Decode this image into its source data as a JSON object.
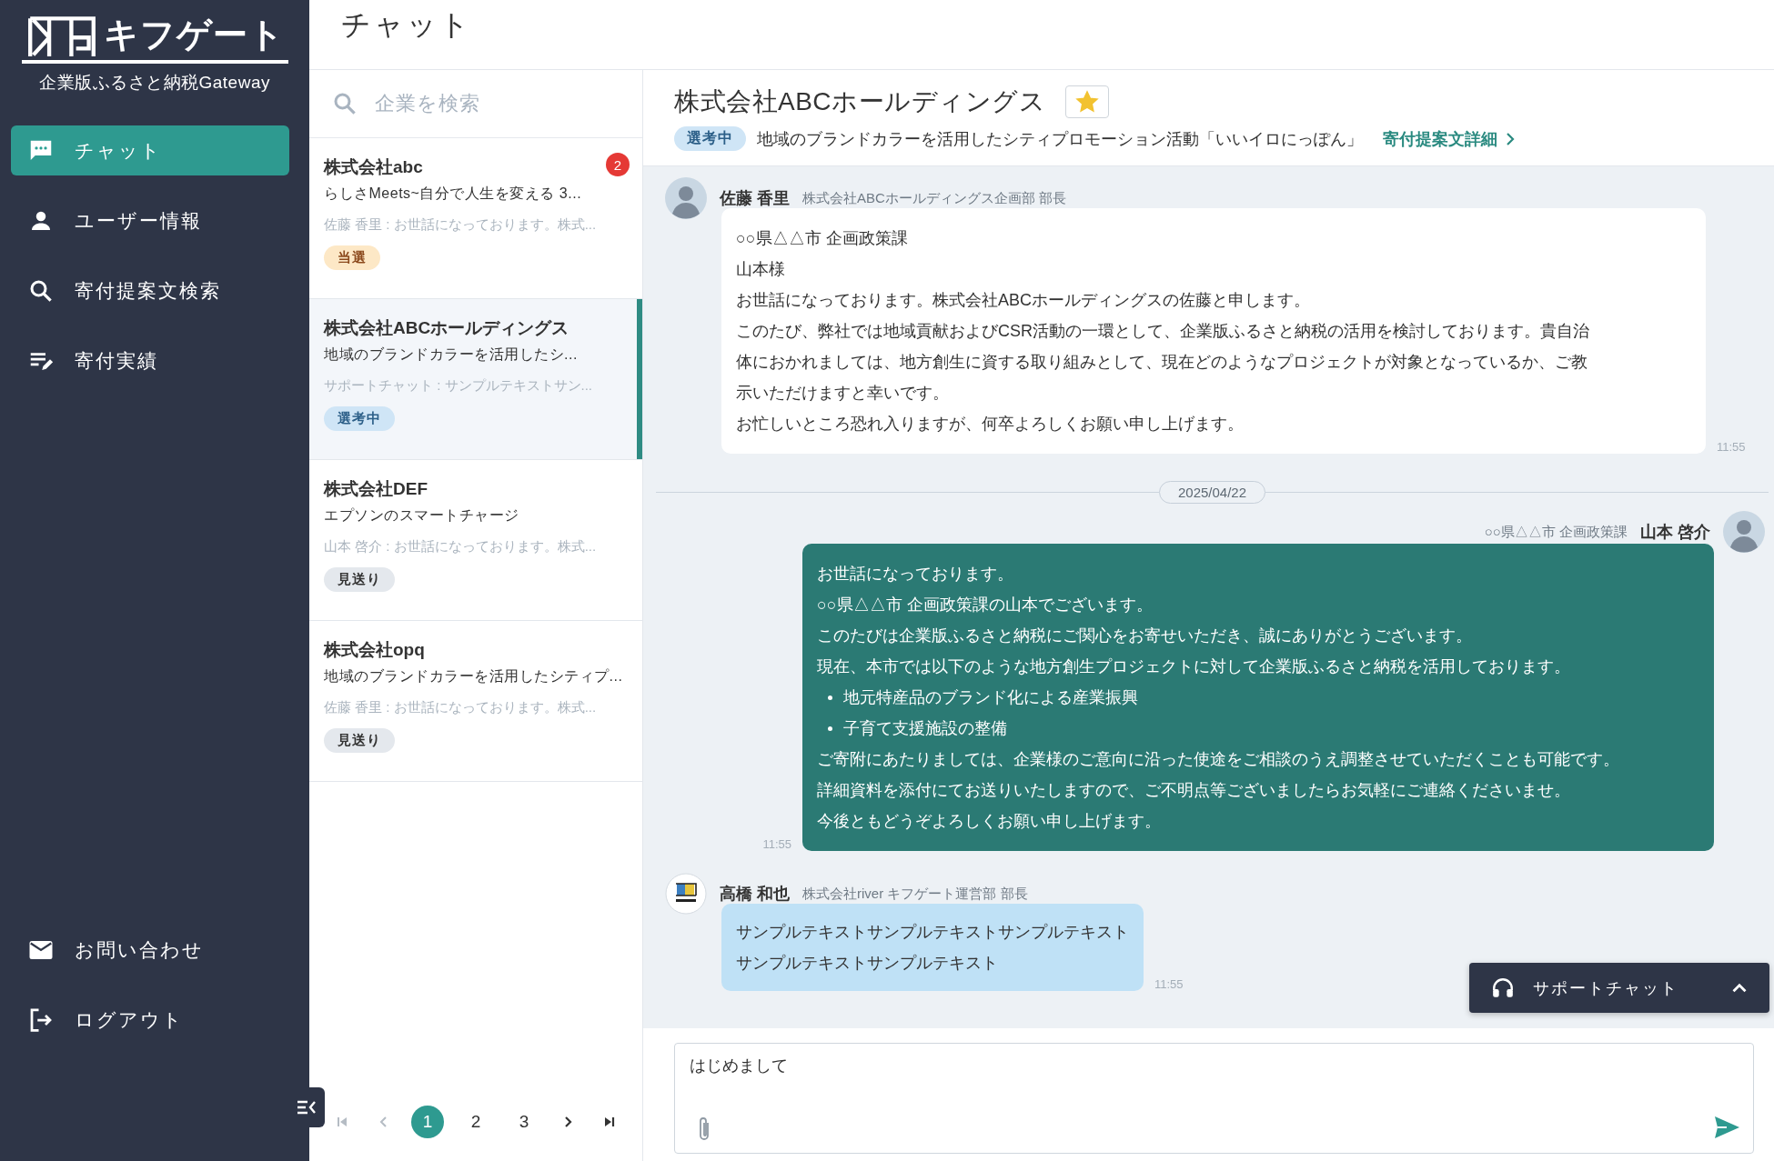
{
  "brand": {
    "logo_text": "キフゲート",
    "tagline": "企業版ふるさと納税Gateway"
  },
  "sidebar": {
    "items": [
      {
        "label": "チャット",
        "selected": true
      },
      {
        "label": "ユーザー情報",
        "selected": false
      },
      {
        "label": "寄付提案文検索",
        "selected": false
      },
      {
        "label": "寄付実績",
        "selected": false
      }
    ],
    "footer_items": [
      {
        "label": "お問い合わせ"
      },
      {
        "label": "ログアウト"
      }
    ]
  },
  "page_title": "チャット",
  "search": {
    "placeholder": "企業を検索"
  },
  "conversations": [
    {
      "company": "株式会社abc",
      "subject": "らしさMeets~自分で人生を変える 3...",
      "preview": "佐藤 香里 : お世話になっております。株式...",
      "status": {
        "label": "当選",
        "kind": "won"
      },
      "badge": "2",
      "selected": false
    },
    {
      "company": "株式会社ABCホールディングス",
      "subject": "地域のブランドカラーを活用したシ...",
      "preview": "サポートチャット : サンプルテキストサン...",
      "status": {
        "label": "選考中",
        "kind": "reviewing"
      },
      "selected": true
    },
    {
      "company": "株式会社DEF",
      "subject": "エプソンのスマートチャージ",
      "preview": "山本 啓介 : お世話になっております。株式...",
      "status": {
        "label": "見送り",
        "kind": "declined"
      },
      "selected": false
    },
    {
      "company": "株式会社opq",
      "subject": "地域のブランドカラーを活用したシティプ...",
      "preview": "佐藤 香里 : お世話になっております。株式...",
      "status": {
        "label": "見送り",
        "kind": "declined"
      },
      "selected": false
    }
  ],
  "pagination": {
    "first": {
      "disabled": true
    },
    "prev": {
      "disabled": true
    },
    "next": {
      "disabled": false
    },
    "last": {
      "disabled": false
    },
    "pages": [
      {
        "label": "1",
        "selected": true
      },
      {
        "label": "2",
        "selected": false
      },
      {
        "label": "3",
        "selected": false
      }
    ]
  },
  "chat": {
    "title": "株式会社ABCホールディングス",
    "starred": true,
    "status": {
      "label": "選考中",
      "kind": "reviewing"
    },
    "proposal": "地域のブランドカラーを活用したシティプロモーション活動「いいイロにっぽん」",
    "proposal_link": "寄付提案文詳細"
  },
  "messages": [
    {
      "kind": "incoming",
      "name": "佐藤 香里",
      "affiliation": "株式会社ABCホールディングス企画部 部長",
      "time": "11:55",
      "lines": [
        {
          "kind": "text",
          "text": "○○県△△市  企画政策課"
        },
        {
          "kind": "text",
          "text": "山本様"
        },
        {
          "kind": "text",
          "text": "お世話になっております。株式会社ABCホールディングスの佐藤と申します。"
        },
        {
          "kind": "text",
          "text": "このたび、弊社では地域貢献およびCSR活動の一環として、企業版ふるさと納税の活用を検討しております。貴自治"
        },
        {
          "kind": "text",
          "text": "体におかれましては、地方創生に資する取り組みとして、現在どのようなプロジェクトが対象となっているか、ご教"
        },
        {
          "kind": "text",
          "text": "示いただけますと幸いです。"
        },
        {
          "kind": "text",
          "text": "お忙しいところ恐れ入りますが、何卒よろしくお願い申し上げます。"
        }
      ]
    },
    {
      "kind": "date",
      "label": "2025/04/22"
    },
    {
      "kind": "outgoing",
      "name": "山本 啓介",
      "affiliation": "○○県△△市 企画政策課",
      "time": "11:55",
      "lines": [
        {
          "kind": "text",
          "text": "お世話になっております。"
        },
        {
          "kind": "text",
          "text": " ○○県△△市 企画政策課の山本でございます。"
        },
        {
          "kind": "text",
          "text": "このたびは企業版ふるさと納税にご関心をお寄せいただき、誠にありがとうございます。"
        },
        {
          "kind": "text",
          "text": "現在、本市では以下のような地方創生プロジェクトに対して企業版ふるさと納税を活用しております。"
        },
        {
          "kind": "bullet",
          "text": "地元特産品のブランド化による産業振興"
        },
        {
          "kind": "bullet",
          "text": "子育て支援施設の整備"
        },
        {
          "kind": "text",
          "text": "ご寄附にあたりましては、企業様のご意向に沿った使途をご相談のうえ調整させていただくことも可能です。"
        },
        {
          "kind": "text",
          "text": "詳細資料を添付にてお送りいたしますので、ご不明点等ございましたらお気軽にご連絡くださいませ。"
        },
        {
          "kind": "text",
          "text": "今後ともどうぞよろしくお願い申し上げます。"
        }
      ]
    },
    {
      "kind": "support",
      "name": "高橋 和也",
      "affiliation": "株式会社river キフゲート運営部 部長",
      "time": "11:55",
      "lines": [
        {
          "kind": "text",
          "text": "サンプルテキストサンプルテキストサンプルテキスト"
        },
        {
          "kind": "text",
          "text": "サンプルテキストサンプルテキスト"
        }
      ]
    }
  ],
  "support_chat": {
    "label": "サポートチャット",
    "expanded": false
  },
  "composer": {
    "value": "はじめまして"
  }
}
